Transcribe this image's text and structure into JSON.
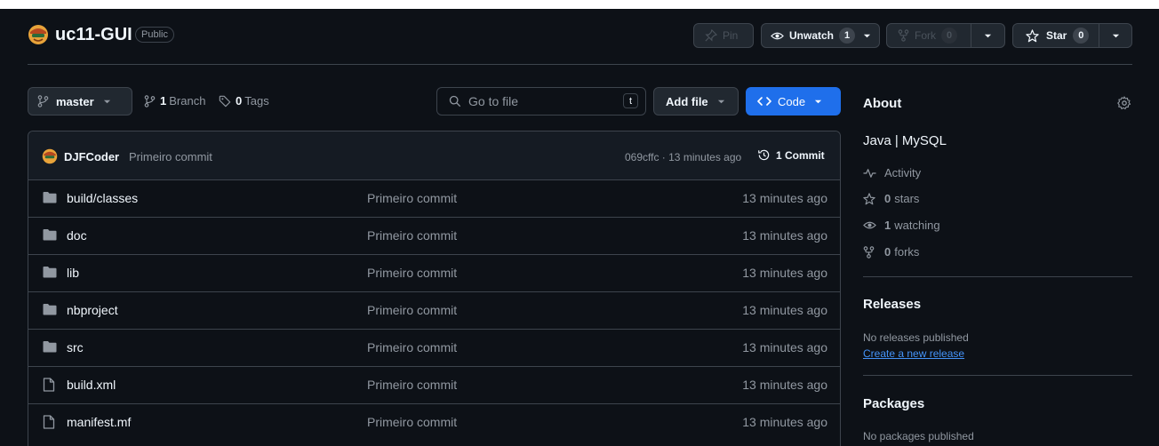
{
  "repo": {
    "name": "uc11-GUI",
    "visibility": "Public"
  },
  "header_actions": {
    "pin_label": "Pin",
    "unwatch_label": "Unwatch",
    "unwatch_count": "1",
    "fork_label": "Fork",
    "fork_count": "0",
    "star_label": "Star",
    "star_count": "0"
  },
  "toolbar": {
    "branch": "master",
    "branch_count": "1",
    "branch_label": "Branch",
    "tag_count": "0",
    "tag_label": "Tags",
    "search_placeholder": "Go to file",
    "search_shortcut": "t",
    "add_file_label": "Add file",
    "code_label": "Code"
  },
  "latest_commit": {
    "author": "DJFCoder",
    "message": "Primeiro commit",
    "info": "069cffc · 13 minutes ago",
    "commit_count_label": "1 Commit"
  },
  "files": [
    {
      "name": "build/classes",
      "type": "folder",
      "commit": "Primeiro commit",
      "time": "13 minutes ago"
    },
    {
      "name": "doc",
      "type": "folder",
      "commit": "Primeiro commit",
      "time": "13 minutes ago"
    },
    {
      "name": "lib",
      "type": "folder",
      "commit": "Primeiro commit",
      "time": "13 minutes ago"
    },
    {
      "name": "nbproject",
      "type": "folder",
      "commit": "Primeiro commit",
      "time": "13 minutes ago"
    },
    {
      "name": "src",
      "type": "folder",
      "commit": "Primeiro commit",
      "time": "13 minutes ago"
    },
    {
      "name": "build.xml",
      "type": "file",
      "commit": "Primeiro commit",
      "time": "13 minutes ago"
    },
    {
      "name": "manifest.mf",
      "type": "file",
      "commit": "Primeiro commit",
      "time": "13 minutes ago"
    }
  ],
  "about": {
    "title": "About",
    "description": "Java | MySQL",
    "activity_label": "Activity",
    "stars_count": "0",
    "stars_label": "stars",
    "watching_count": "1",
    "watching_label": "watching",
    "forks_count": "0",
    "forks_label": "forks"
  },
  "releases": {
    "title": "Releases",
    "empty_text": "No releases published",
    "create_link": "Create a new release"
  },
  "packages": {
    "title": "Packages",
    "empty_text": "No packages published"
  },
  "colors": {
    "background": "#0d1117",
    "border": "#3d444d",
    "accent_button": "#1f6feb",
    "link": "#4493f8",
    "folder_icon": "#9198a1"
  }
}
